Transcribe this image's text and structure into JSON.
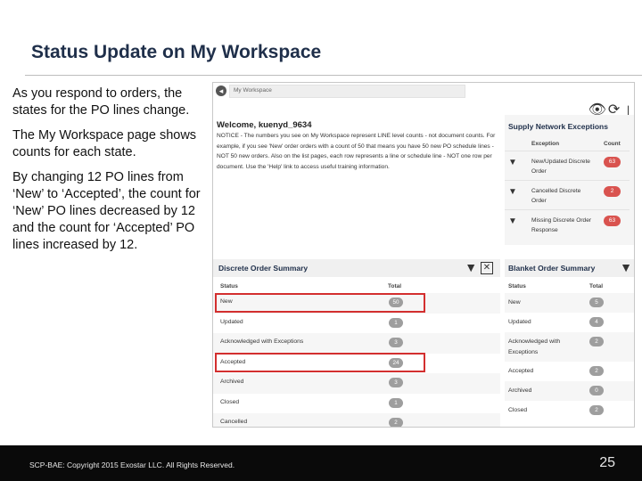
{
  "slide": {
    "title": "Status Update on My Workspace",
    "paragraphs": [
      "As you respond to orders, the states for the PO lines change.",
      "The My Workspace page shows counts for each state.",
      "By changing 12 PO lines from ‘New’ to ‘Accepted’, the count for ‘New’ PO lines decreased by 12 and the count for ‘Accepted’ PO lines increased by 12."
    ],
    "footer": "SCP-BAE:  Copyright 2015 Exostar LLC. All Rights Reserved.",
    "page_number": "25"
  },
  "workspace": {
    "breadcrumb": "My Workspace",
    "welcome": "Welcome, kuenyd_9634",
    "notice": "NOTICE - The numbers you see on My Workspace represent LINE level counts - not document counts. For example, if you see 'New' order orders with a count of 50 that means you have 50 new PO schedule lines - NOT 50 new orders. Also on the list pages, each row represents a line or schedule line - NOT one row per document. Use the 'Help' link to access useful training information.",
    "toolbar_icons": [
      "eye-icon",
      "refresh-icon",
      "scroll-icon"
    ],
    "supply_network": {
      "title": "Supply Network Exceptions",
      "col_exception": "Exception",
      "col_count": "Count",
      "rows": [
        {
          "label": "New/Updated Discrete Order",
          "count": "63"
        },
        {
          "label": "Cancelled Discrete Order",
          "count": "2"
        },
        {
          "label": "Missing Discrete Order Response",
          "count": "63"
        }
      ]
    },
    "discrete": {
      "title": "Discrete Order Summary",
      "col_status": "Status",
      "col_total": "Total",
      "rows": [
        {
          "status": "New",
          "total": "50"
        },
        {
          "status": "Updated",
          "total": "1"
        },
        {
          "status": "Acknowledged with Exceptions",
          "total": "3"
        },
        {
          "status": "Accepted",
          "total": "24"
        },
        {
          "status": "Archived",
          "total": "3"
        },
        {
          "status": "Closed",
          "total": "1"
        },
        {
          "status": "Cancelled",
          "total": "2"
        }
      ]
    },
    "blanket": {
      "title": "Blanket Order Summary",
      "col_status": "Status",
      "col_total": "Total",
      "rows": [
        {
          "status": "New",
          "total": "5"
        },
        {
          "status": "Updated",
          "total": "4"
        },
        {
          "status": "Acknowledged with Exceptions",
          "total": "2"
        },
        {
          "status": "Accepted",
          "total": "2"
        },
        {
          "status": "Archived",
          "total": "0"
        },
        {
          "status": "Closed",
          "total": "2"
        }
      ]
    },
    "colors": {
      "badge_red": "#d9534f",
      "badge_grey": "#9e9e9e",
      "highlight": "#d32f2f"
    }
  }
}
